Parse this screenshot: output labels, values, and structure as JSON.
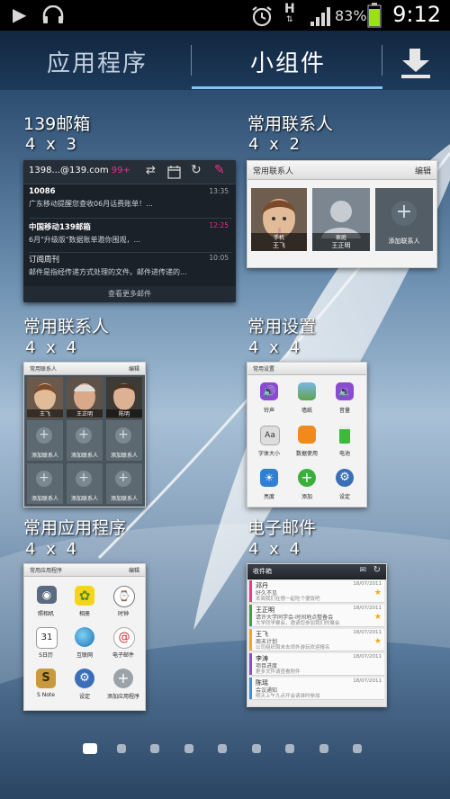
{
  "status_bar": {
    "time": "9:12",
    "battery_percent": "83%",
    "icons": [
      "play-icon",
      "headset-icon",
      "alarm-icon",
      "hspa-icon",
      "signal-icon",
      "battery-icon"
    ],
    "network_label": "H"
  },
  "tabs": [
    {
      "label": "应用程序",
      "active": false
    },
    {
      "label": "小组件",
      "active": true
    }
  ],
  "widgets": {
    "mail139": {
      "title": "139邮箱",
      "size": "4 x 3",
      "account": "1398...@139.com",
      "badge": "99+",
      "rows": [
        {
          "sender": "10086",
          "preview": "广东移动提醒您查收06月话费账单！...",
          "time": "13:35"
        },
        {
          "sender": "中国移动139邮箱",
          "preview": "6月\"升级版\"数据账单邀你围观，...",
          "time": "12:25"
        },
        {
          "sender": "订阅周刊",
          "preview": "邮件是指经传递方式处理的文件。邮件进传递的...",
          "time": "10:05"
        }
      ],
      "more": "查看更多邮件"
    },
    "contacts_4x2": {
      "title": "常用联系人",
      "size": "4 x 2",
      "header": "常用联系人",
      "edit": "编辑",
      "contacts": [
        {
          "type": "手机",
          "name": "王飞"
        },
        {
          "type": "家庭",
          "name": "王正明"
        }
      ],
      "add_label": "添加联系人"
    },
    "contacts_4x4": {
      "title": "常用联系人",
      "size": "4 x 4",
      "header": "常用联系人",
      "edit": "编辑",
      "names": [
        "王飞",
        "王正明",
        "陈明"
      ],
      "add_label": "添加联系人"
    },
    "settings": {
      "title": "常用设置",
      "size": "4 x 4",
      "header": "常用设置",
      "items": [
        "铃声",
        "墙纸",
        "音量",
        "字体大小",
        "数据使用",
        "电池",
        "亮度",
        "添加",
        "设定"
      ]
    },
    "apps": {
      "title": "常用应用程序",
      "size": "4 x 4",
      "header": "常用应用程序",
      "edit": "编辑",
      "items": [
        "照相机",
        "相册",
        "时钟",
        "S日历",
        "互联网",
        "电子邮件",
        "S Note",
        "设定",
        "添加应用程序"
      ]
    },
    "email": {
      "title": "电子邮件",
      "size": "4 x 4",
      "header": "收件箱",
      "rows": [
        {
          "name": "邓丹",
          "subject": "好久不见",
          "preview": "本周我们在想一起吃个便饭吧",
          "date": "18/07/2011",
          "color": "#e83b8a",
          "star": true
        },
        {
          "name": "王正明",
          "subject": "请许大学同学会-时间地点整备会",
          "preview": "大学同学聚会，邀请您参加我们的聚会",
          "date": "18/07/2011",
          "color": "#3aa63a",
          "star": true
        },
        {
          "name": "王飞",
          "subject": "周末计划",
          "preview": "公司组织周末去郊外游玩欢迎报名",
          "date": "18/07/2011",
          "color": "#f2a81d",
          "star": true
        },
        {
          "name": "李涛",
          "subject": "项目进度",
          "preview": "更多文件请查看附件",
          "date": "18/07/2011",
          "color": "#8a4bd0",
          "star": false
        },
        {
          "name": "陈瑶",
          "subject": "会议通知",
          "preview": "明天上午九点开会请准时参加",
          "date": "18/07/2011",
          "color": "#3a8fe0",
          "star": false
        }
      ]
    }
  },
  "page_indicator": {
    "count": 9,
    "active": 0
  }
}
